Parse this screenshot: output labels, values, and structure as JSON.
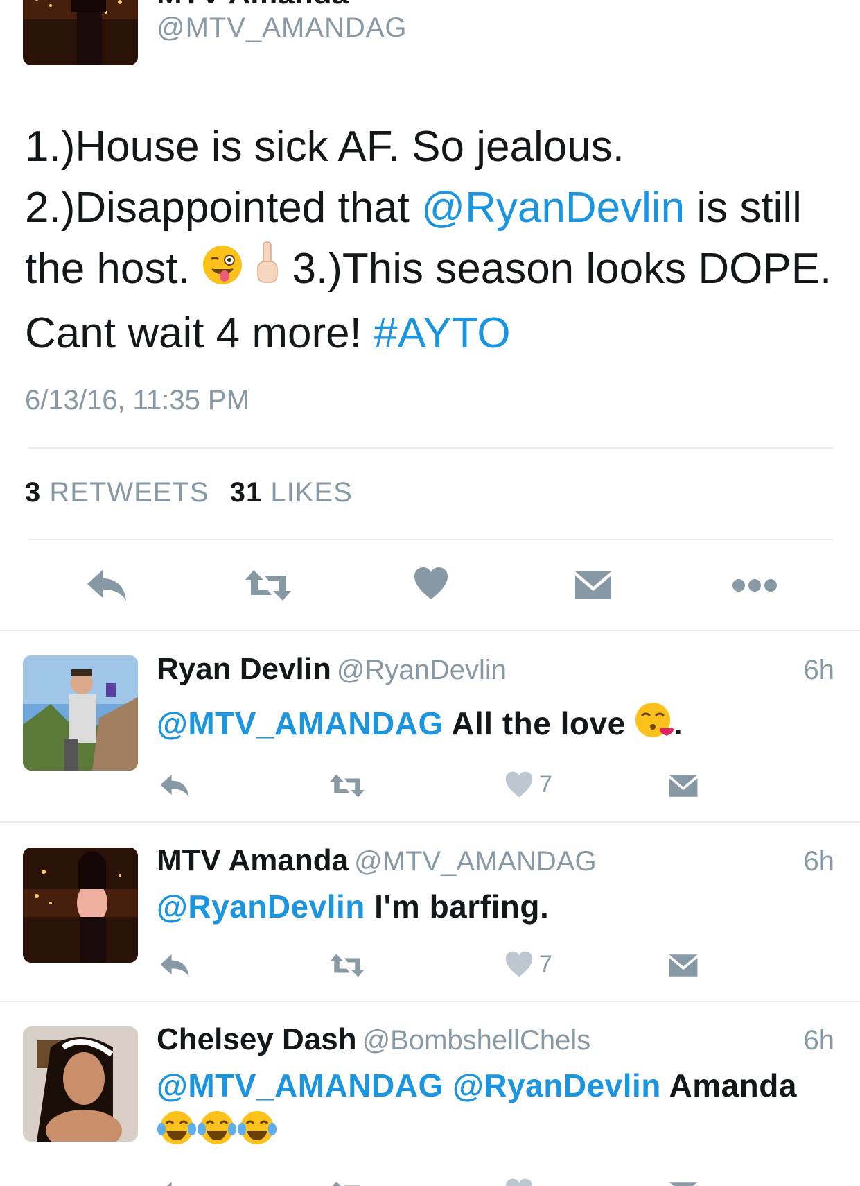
{
  "main_tweet": {
    "name_partial": "MTV Amanda",
    "handle": "@MTV_AMANDAG",
    "text_line1": "1.)House is sick AF. So jealous.",
    "text_2a": "2.)Disappointed that ",
    "text_2b": "@RyanDevlin",
    "text_2c": " is still the host. ",
    "text_3a": " 3.)This season looks DOPE. Cant wait 4 more! ",
    "hashtag": "#AYTO",
    "timestamp": "6/13/16, 11:35 PM",
    "retweets_count": "3",
    "retweets_label": "RETWEETS",
    "likes_count": "31",
    "likes_label": "LIKES",
    "emojis": [
      "winking-face-tongue-emoji",
      "middle-finger-emoji"
    ]
  },
  "replies": [
    {
      "name": "Ryan Devlin",
      "handle": "@RyanDevlin",
      "time": "6h",
      "mention": "@MTV_AMANDAG",
      "text": " All the love ",
      "suffix": ".",
      "emoji": "face-blowing-kiss-emoji",
      "likes": "7"
    },
    {
      "name": "MTV Amanda",
      "handle": "@MTV_AMANDAG",
      "time": "6h",
      "mention": "@RyanDevlin",
      "text": " I'm barfing.",
      "likes": "7"
    },
    {
      "name": "Chelsey Dash",
      "handle": "@BombshellChels",
      "time": "6h",
      "mention": "@MTV_AMANDAG",
      "mention2": "@RyanDevlin",
      "text": " Amanda",
      "emojis": [
        "tears-of-joy-emoji",
        "tears-of-joy-emoji",
        "tears-of-joy-emoji"
      ]
    }
  ],
  "colors": {
    "link": "#1b95e0",
    "muted": "#8899a6",
    "icon": "#8899a6",
    "divider": "#e6ecf0",
    "text": "#14171a"
  }
}
